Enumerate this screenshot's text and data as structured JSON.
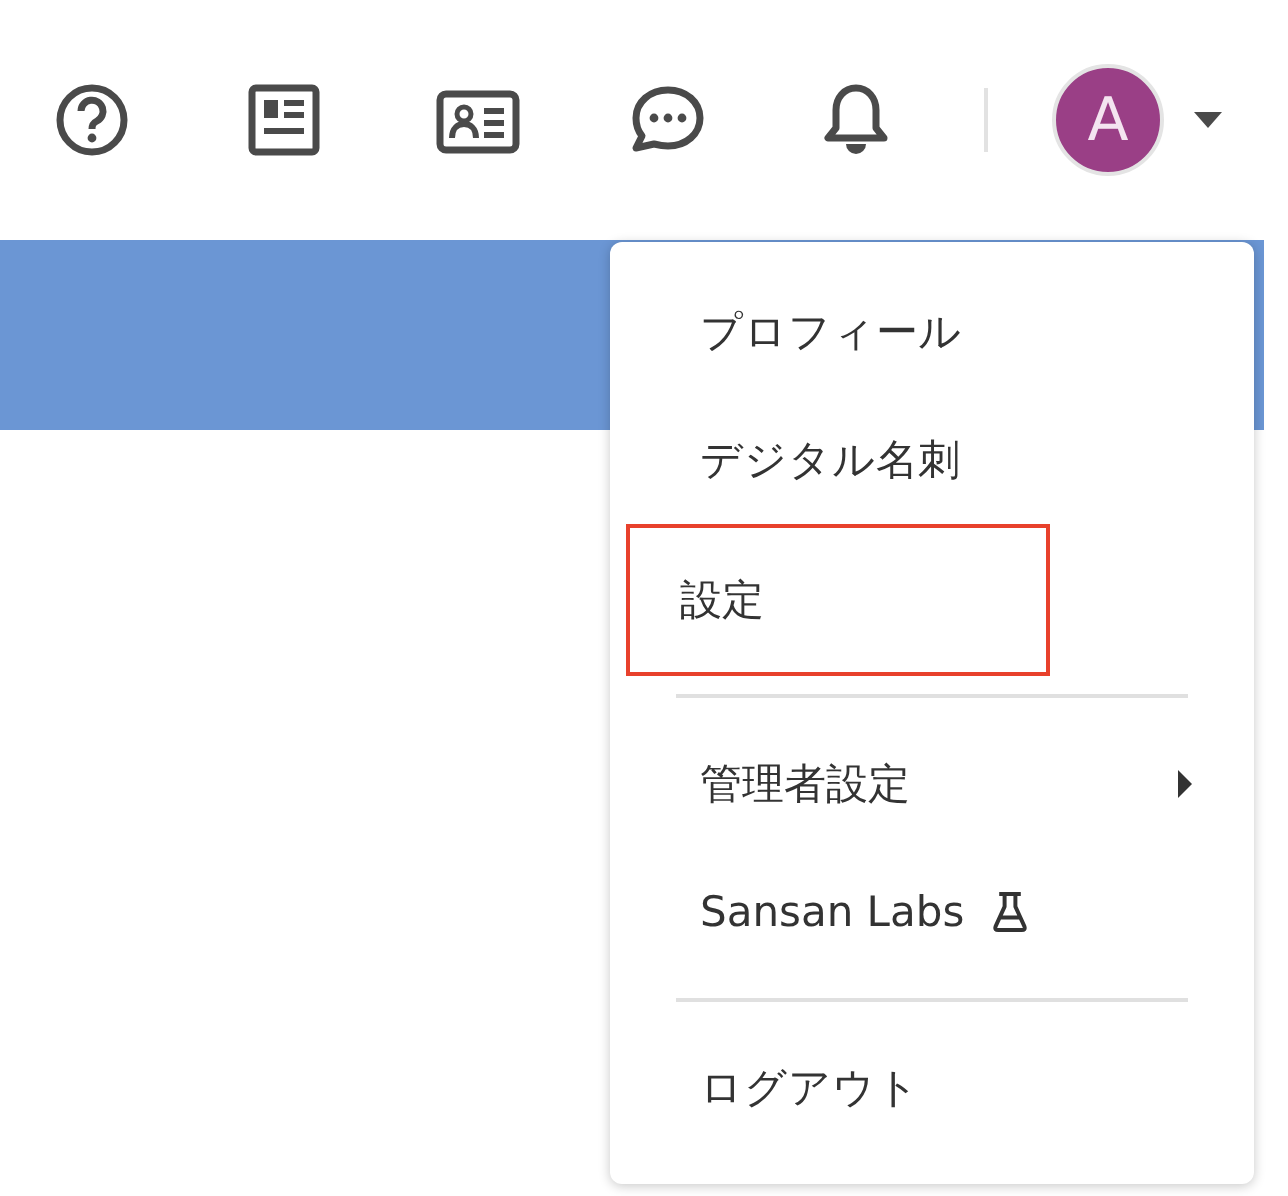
{
  "header": {
    "icons": [
      {
        "kind": "help"
      },
      {
        "kind": "news"
      },
      {
        "kind": "card"
      },
      {
        "kind": "chat"
      },
      {
        "kind": "bell"
      }
    ],
    "avatar": {
      "initial": "A"
    }
  },
  "menu": {
    "items": [
      {
        "kind": "item",
        "label": "プロフィール",
        "highlighted": false,
        "submenu": false
      },
      {
        "kind": "item",
        "label": "デジタル名刺",
        "highlighted": false,
        "submenu": false
      },
      {
        "kind": "item",
        "label": "設定",
        "highlighted": true,
        "submenu": false
      },
      {
        "kind": "divider"
      },
      {
        "kind": "item",
        "label": "管理者設定",
        "highlighted": false,
        "submenu": true
      },
      {
        "kind": "labs",
        "label": "Sansan Labs",
        "highlighted": false,
        "submenu": false
      },
      {
        "kind": "divider"
      },
      {
        "kind": "item",
        "label": "ログアウト",
        "highlighted": false,
        "submenu": false
      }
    ]
  }
}
